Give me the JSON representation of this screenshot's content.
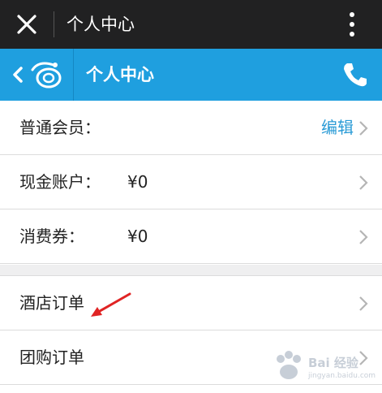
{
  "browser_bar": {
    "title": "个人中心",
    "close_icon": "close-icon",
    "more_icon": "more-vertical-icon"
  },
  "nav_bar": {
    "title": "个人中心",
    "back_icon": "back-logo-icon",
    "phone_icon": "phone-icon",
    "accent_color": "#1f9fdf"
  },
  "rows": [
    {
      "label": "普通会员：",
      "value": "",
      "action": "编辑"
    },
    {
      "label": "现金账户：",
      "value": "¥0"
    },
    {
      "label": "消费券：",
      "value": "¥0"
    },
    {
      "label": "酒店订单",
      "value": ""
    },
    {
      "label": "团购订单",
      "value": ""
    }
  ],
  "watermark": {
    "text": "Bai 经验",
    "sub": "jingyan.baidu.com"
  }
}
